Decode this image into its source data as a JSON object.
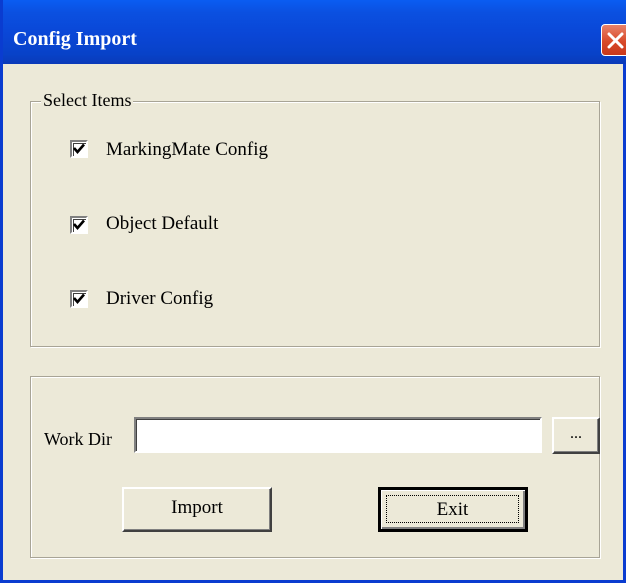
{
  "window": {
    "title": "Config Import"
  },
  "select_items": {
    "legend": "Select Items",
    "items": [
      {
        "label": "MarkingMate Config",
        "checked": true
      },
      {
        "label": "Object Default",
        "checked": true
      },
      {
        "label": "Driver Config",
        "checked": true
      }
    ]
  },
  "work_dir": {
    "label": "Work Dir",
    "value": "",
    "browse_label": "..."
  },
  "buttons": {
    "import": "Import",
    "exit": "Exit"
  },
  "colors": {
    "titlebar": "#0a46d6",
    "close_button": "#d84a2a",
    "face": "#ece9d8"
  }
}
